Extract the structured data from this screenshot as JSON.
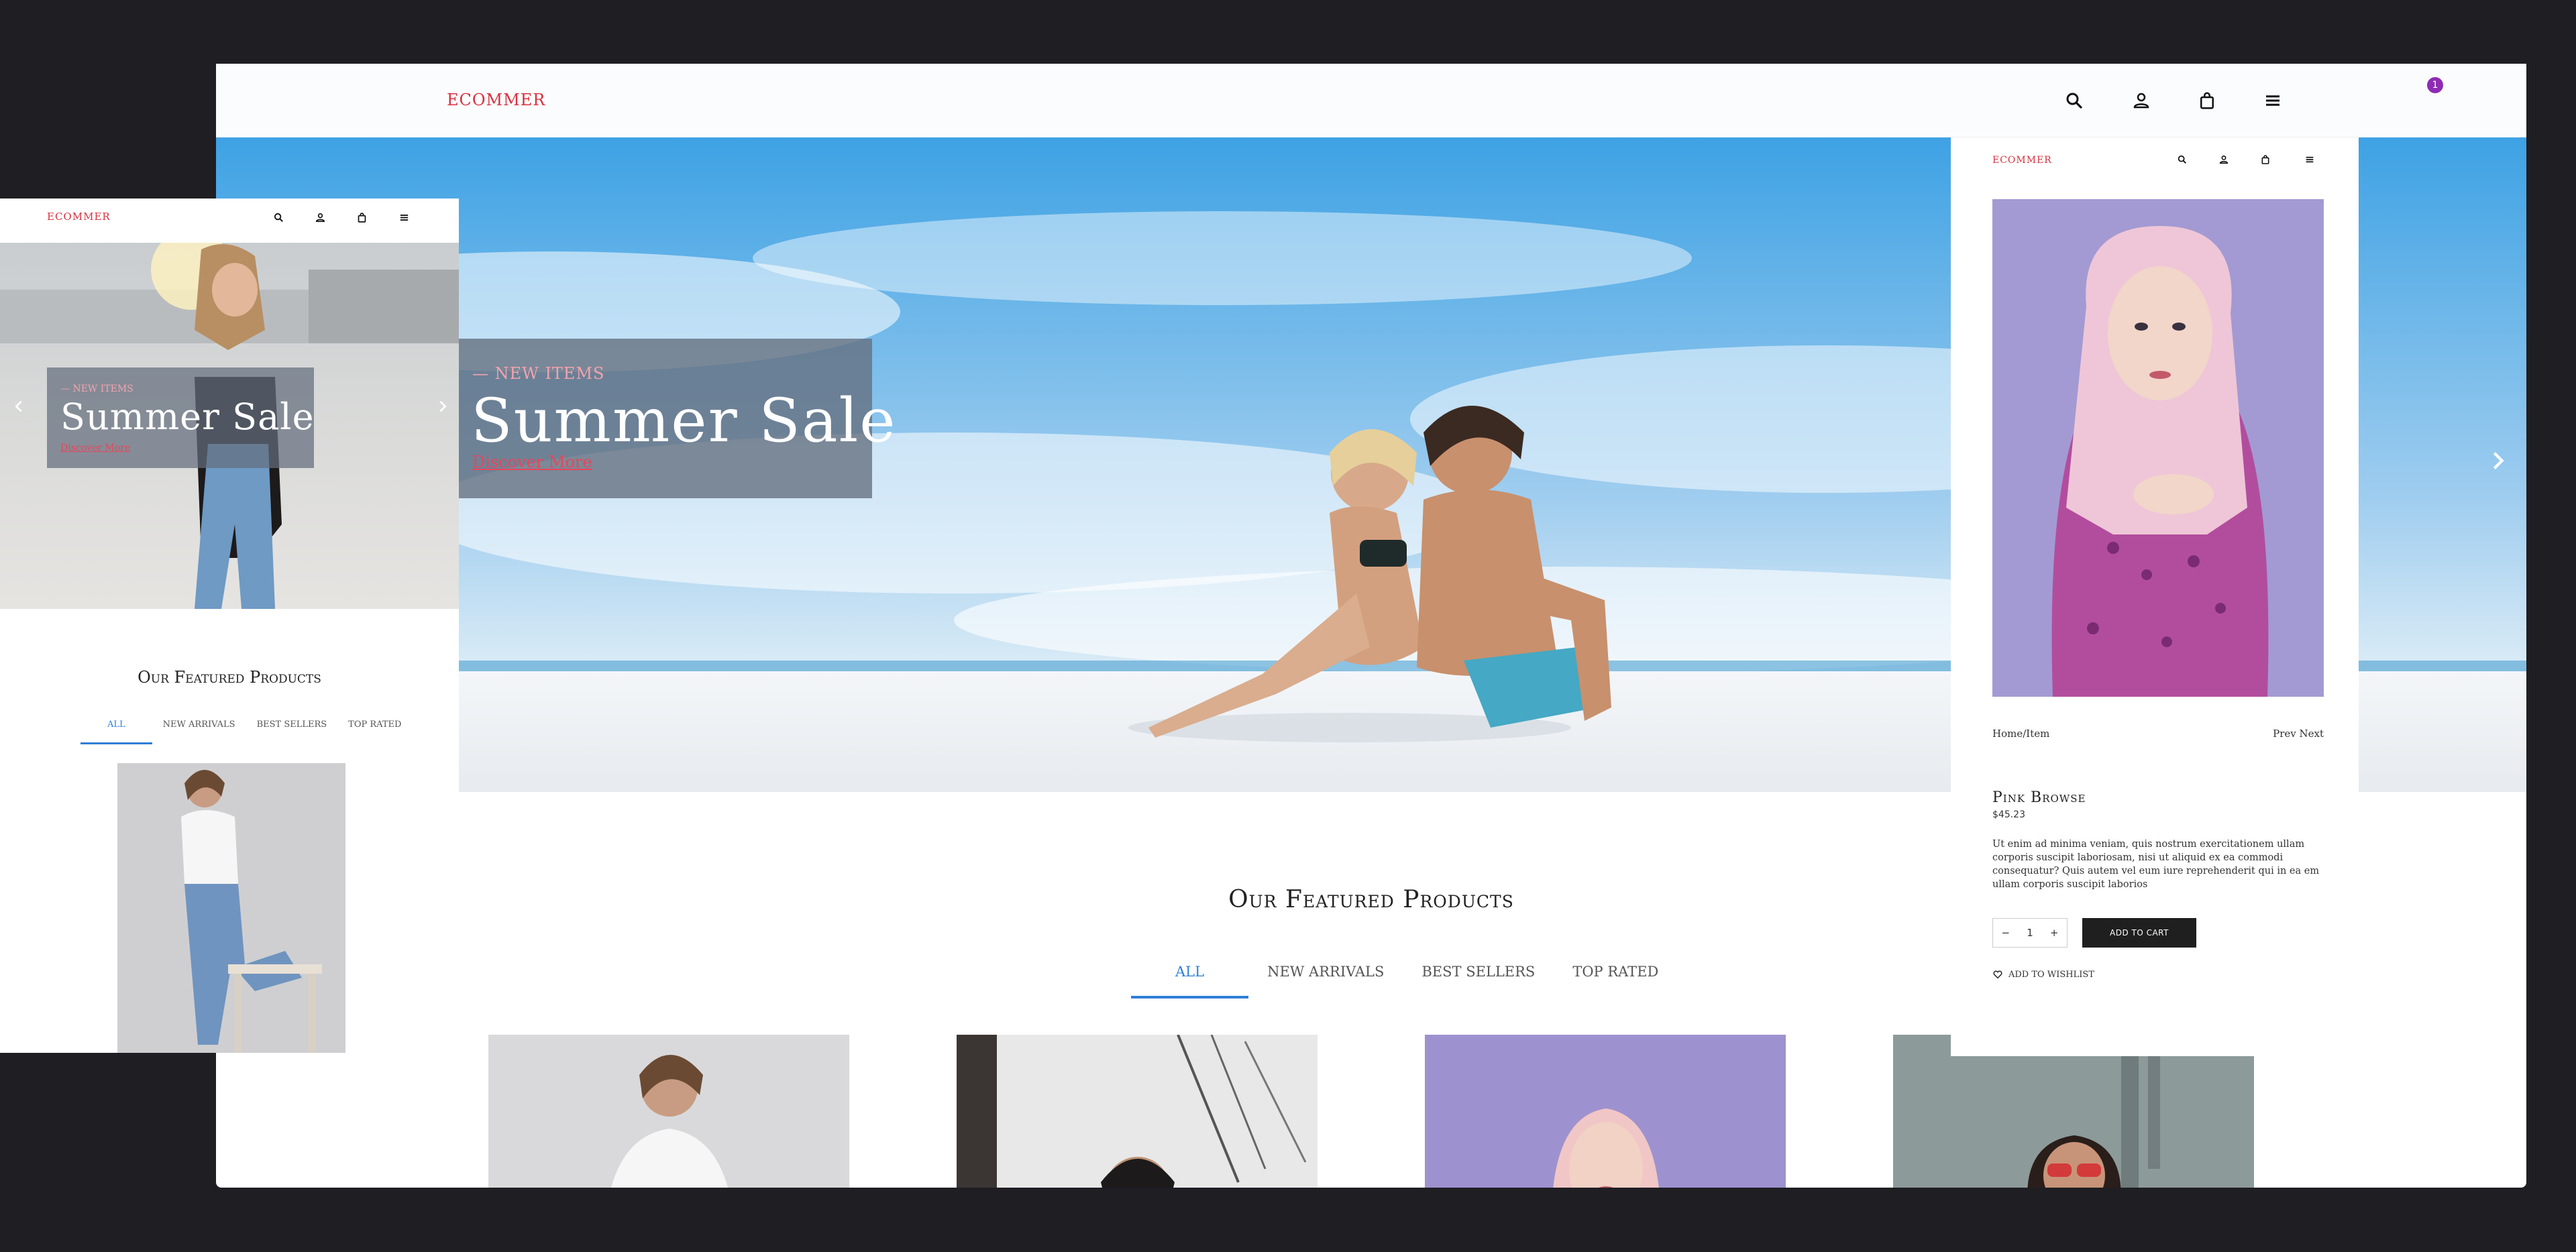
{
  "colors": {
    "accent": "#2f7fd6",
    "brand": "#d9303f",
    "badge": "#8e2bb3",
    "link": "#e9455a",
    "background": "#1f1e23"
  },
  "desktop": {
    "logo": "ECOMMER",
    "header_icons": [
      "search-icon",
      "user-icon",
      "shopping-bag-icon",
      "menu-icon"
    ],
    "cart_badge": "1",
    "hero": {
      "eyebrow": "— NEW ITEMS",
      "title": "Summer Sale",
      "link": "Discover More"
    },
    "featured": {
      "title_light": "Our Featured",
      "title_bold": "Products"
    },
    "tabs": [
      {
        "label": "ALL",
        "active": true
      },
      {
        "label": "NEW ARRIVALS",
        "active": false
      },
      {
        "label": "BEST SELLERS",
        "active": false
      },
      {
        "label": "TOP RATED",
        "active": false
      }
    ]
  },
  "detail": {
    "logo": "ECOMMER",
    "breadcrumb": "Home/Item",
    "pager": "Prev Next",
    "product_name": "Pink Browse",
    "price": "$45.23",
    "description": "Ut enim ad minima veniam, quis nostrum exercitationem ullam corporis suscipit laboriosam, nisi ut aliquid ex ea commodi consequatur? Quis autem vel eum iure reprehenderit qui in ea em ullam corporis suscipit laborios",
    "qty_minus": "−",
    "qty": "1",
    "qty_plus": "+",
    "add_to_cart": "ADD TO CART",
    "wishlist": "ADD TO WISHLIST"
  },
  "mobile": {
    "logo": "ECOMMER",
    "hero": {
      "eyebrow": "— NEW ITEMS",
      "title": "Summer Sale",
      "link": "Discover More"
    },
    "featured": {
      "title_light": "Our Featured",
      "title_bold": "Products"
    },
    "tabs": [
      {
        "label": "ALL",
        "active": true
      },
      {
        "label": "NEW ARRIVALS",
        "active": false
      },
      {
        "label": "BEST SELLERS",
        "active": false
      },
      {
        "label": "TOP RATED",
        "active": false
      }
    ]
  }
}
